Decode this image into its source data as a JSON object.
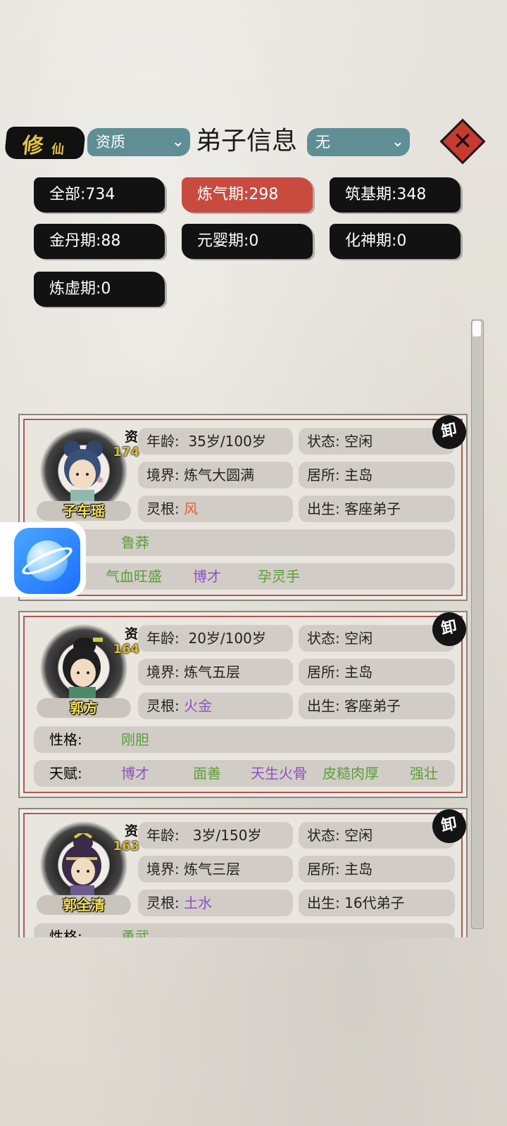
{
  "header": {
    "brand_big": "修",
    "brand_small": "仙",
    "sort_select": "资质",
    "title": "弟子信息",
    "filter_select": "无"
  },
  "stage_filters": [
    {
      "label": "全部:734",
      "active": false
    },
    {
      "label": "炼气期:298",
      "active": true
    },
    {
      "label": "筑基期:348",
      "active": false
    },
    {
      "label": "金丹期:88",
      "active": false
    },
    {
      "label": "元婴期:0",
      "active": false
    },
    {
      "label": "化神期:0",
      "active": false
    },
    {
      "label": "炼虚期:0",
      "active": false
    }
  ],
  "labels": {
    "aptitude": "资",
    "age": "年龄:",
    "status": "状态:",
    "realm": "境界:",
    "residence": "居所:",
    "root": "灵根:",
    "origin": "出生:",
    "personality": "性格:",
    "talent": "天赋:",
    "dismiss": "卸"
  },
  "disciples": [
    {
      "name": "子车瑶",
      "aptitude": "174",
      "age": "35岁/100岁",
      "status": "空闲",
      "realm": "炼气大圆满",
      "residence": "主岛",
      "root": "风",
      "origin": "客座弟子",
      "personality": "鲁莽",
      "talents": [
        "气血旺盛",
        "博才",
        "孕灵手"
      ]
    },
    {
      "name": "郭方",
      "aptitude": "164",
      "age": "20岁/100岁",
      "status": "空闲",
      "realm": "炼气五层",
      "residence": "主岛",
      "root": "火金",
      "origin": "客座弟子",
      "personality": "刚胆",
      "talents": [
        "博才",
        "面善",
        "天生火骨",
        "皮糙肉厚",
        "强壮"
      ]
    },
    {
      "name": "郭全清",
      "aptitude": "163",
      "age": "3岁/150岁",
      "status": "空闲",
      "realm": "炼气三层",
      "residence": "主岛",
      "root": "土水",
      "origin": "16代弟子",
      "personality": "勇武",
      "talents": []
    }
  ],
  "colors": {
    "accent_red": "#c94a3f",
    "pill_black": "#121212",
    "select_teal": "#5f8f94",
    "name_yellow": "#f3e05a",
    "trait_green": "#5c9d3b",
    "trait_purple": "#8e4fc4",
    "root_orange": "#e3612d"
  },
  "icons": {
    "close": "close-x-icon",
    "dismiss": "dismiss-seal-icon",
    "floating_app": "browser-planet-icon"
  }
}
